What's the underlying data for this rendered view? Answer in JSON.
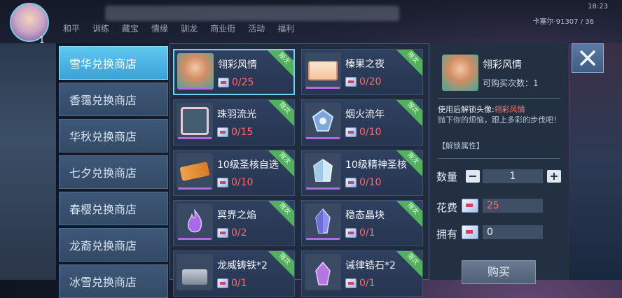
{
  "top": {
    "level": "1",
    "tabs": [
      "和平",
      "训练",
      "藏宝",
      "情缘",
      "驯龙",
      "商业街",
      "活动",
      "福利"
    ],
    "status_time": "18:23",
    "status_server": "卡塞尔·91307 / 36"
  },
  "sidebar": {
    "tabs": [
      {
        "label": "雪华兑换商店",
        "active": true
      },
      {
        "label": "香霭兑换商店",
        "active": false
      },
      {
        "label": "华秋兑换商店",
        "active": false
      },
      {
        "label": "七夕兑换商店",
        "active": false
      },
      {
        "label": "春樱兑换商店",
        "active": false
      },
      {
        "label": "龙裔兑换商店",
        "active": false
      },
      {
        "label": "冰雪兑换商店",
        "active": false
      }
    ]
  },
  "items": [
    {
      "name": "翎彩风情",
      "count": "0/25",
      "badge": "限次",
      "icon": "avatar-icon",
      "selected": true
    },
    {
      "name": "榛果之夜",
      "count": "0/20",
      "badge": "限次",
      "icon": "scroll-icon",
      "selected": false
    },
    {
      "name": "珠羽流光",
      "count": "0/15",
      "badge": "限次",
      "icon": "frame-icon",
      "selected": false
    },
    {
      "name": "烟火流年",
      "count": "0/10",
      "badge": "限次",
      "icon": "emblem-icon",
      "selected": false
    },
    {
      "name": "10级圣核自选",
      "count": "0/10",
      "badge": "限次",
      "icon": "ticket-icon",
      "selected": false
    },
    {
      "name": "10级精神圣核",
      "count": "0/10",
      "badge": "限次",
      "icon": "crystal-icon",
      "selected": false
    },
    {
      "name": "冥界之焰",
      "count": "0/2",
      "badge": "限次",
      "icon": "flame-icon",
      "selected": false
    },
    {
      "name": "稳态晶块",
      "count": "0/1",
      "badge": "限次",
      "icon": "gem-icon",
      "selected": false
    },
    {
      "name": "龙威铸铁*2",
      "count": "0/1",
      "badge": "限次",
      "icon": "iron-icon",
      "selected": false
    },
    {
      "name": "诫律锆石*2",
      "count": "0/1",
      "badge": "限次",
      "icon": "zircon-icon",
      "selected": false
    }
  ],
  "detail": {
    "name": "翎彩风情",
    "buys": "可购买次数：1",
    "desc_prefix": "使用后解锁头像:",
    "desc_highlight": "翎彩风情",
    "desc_body": "抛下你的烦恼，跟上多彩的步伐吧！",
    "attr": "【解锁属性】",
    "qty_label": "数量",
    "qty_value": "1",
    "qty_minus": "−",
    "qty_plus": "+",
    "cost_label": "花费",
    "cost_value": "25",
    "own_label": "拥有",
    "own_value": "0",
    "buy_label": "购买"
  },
  "colors": {
    "accent": "#5fc7ef",
    "count_red": "#ff6b6b",
    "badge_green": "#53b05e"
  }
}
